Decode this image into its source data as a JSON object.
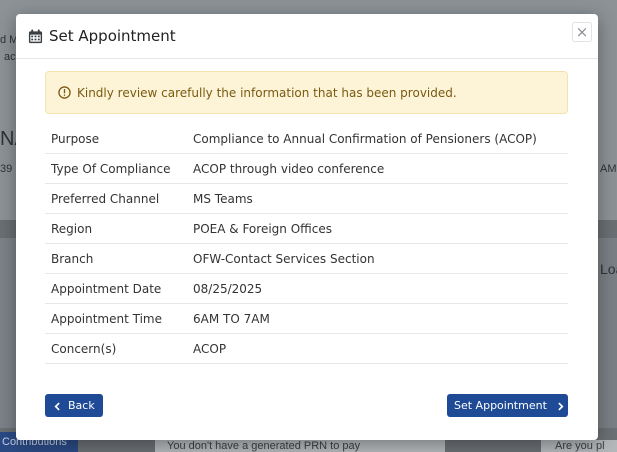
{
  "background": {
    "snippet_1": "d M",
    "snippet_2": "ac",
    "snippet_3": "NA",
    "snippet_4": "39",
    "snippet_5": "AM",
    "snippet_6": "Loa",
    "contributions_label": "Contributions",
    "notice_left": "You don't have a generated PRN to pay",
    "notice_right": "Are you pl"
  },
  "modal": {
    "title": "Set Appointment",
    "header_icon": "calendar-icon",
    "close_label": "×",
    "alert": {
      "icon": "exclamation-circle-icon",
      "text": "Kindly review carefully the information that has been provided.",
      "color": "#fdf4d8"
    },
    "details": [
      {
        "label": "Purpose",
        "value": "Compliance to Annual Confirmation of Pensioners (ACOP)"
      },
      {
        "label": "Type Of Compliance",
        "value": "ACOP through video conference"
      },
      {
        "label": "Preferred Channel",
        "value": "MS Teams"
      },
      {
        "label": "Region",
        "value": "POEA & Foreign Offices"
      },
      {
        "label": "Branch",
        "value": "OFW-Contact Services Section"
      },
      {
        "label": "Appointment Date",
        "value": "08/25/2025"
      },
      {
        "label": "Appointment Time",
        "value": "6AM TO 7AM"
      },
      {
        "label": "Concern(s)",
        "value": "ACOP"
      }
    ],
    "back_label": "Back",
    "submit_label": "Set Appointment",
    "accent_color": "#1f4a96"
  }
}
